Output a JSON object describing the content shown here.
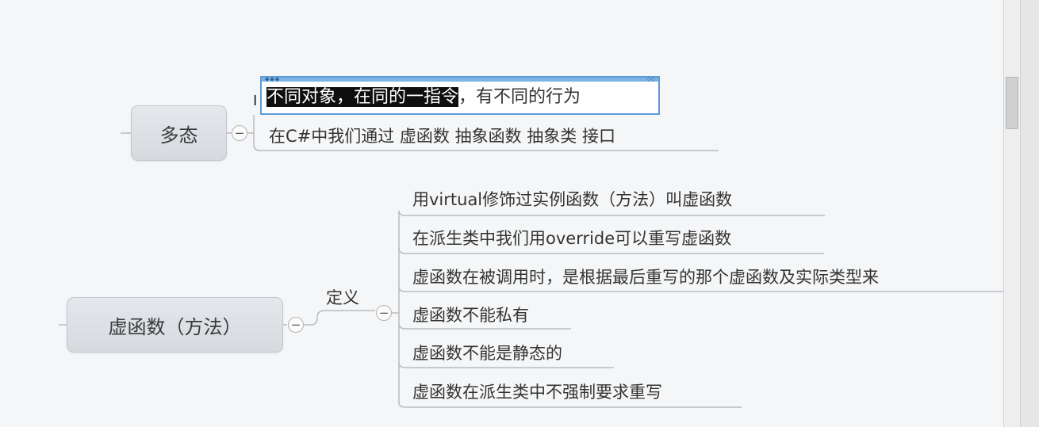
{
  "polymorphism": {
    "title": "多态",
    "children": [
      "有不同的行为",
      "在C#中我们通过 虚函数 抽象函数 抽象类 接口"
    ],
    "editing_text": {
      "selected": "不同对象，在同的一指令",
      "rest": "，有不同的行为"
    }
  },
  "virtual_function": {
    "title": "虚函数（方法）",
    "branch_label": "定义",
    "children": [
      "用virtual修饰过实例函数（方法）叫虚函数",
      "在派生类中我们用override可以重写虚函数",
      "虚函数在被调用时，是根据最后重写的那个虚函数及实际类型来",
      "虚函数不能私有",
      "虚函数不能是静态的",
      "虚函数在派生类中不强制要求重写"
    ]
  },
  "collapse_symbol": "−",
  "cursor_glyph": "I",
  "colors": {
    "topic_fill": "#dcdfe3",
    "line": "#b8bcc0",
    "selection": "#0e0e0e",
    "edit_border": "#5b9bd8"
  }
}
